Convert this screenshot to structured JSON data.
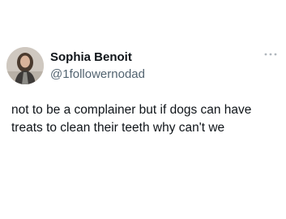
{
  "tweet": {
    "author": {
      "display_name": "Sophia Benoit",
      "handle": "@1followernodad",
      "avatar_icon": "profile-photo"
    },
    "more_icon": "ellipsis-icon",
    "text": "not to be a complainer but if dogs can have treats to clean their teeth why can't we"
  },
  "colors": {
    "text_primary": "#0f1419",
    "text_secondary": "#536471",
    "background": "#ffffff"
  }
}
